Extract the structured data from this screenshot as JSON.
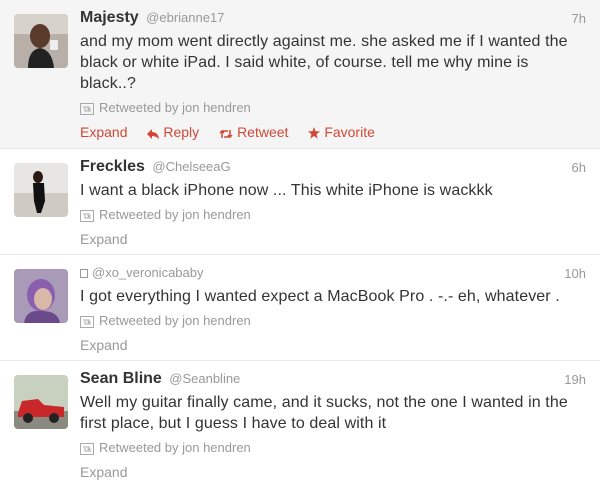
{
  "tweets": [
    {
      "fullname": "Majesty",
      "username": "@ebrianne17",
      "time": "7h",
      "text": "and my mom went directly against me. she asked me if I wanted the black or white iPad. I said white, of course. tell me why mine is black..?",
      "retweeted_by": "Retweeted by jon hendren",
      "actions": {
        "expand": "Expand",
        "reply": "Reply",
        "retweet": "Retweet",
        "favorite": "Favorite"
      }
    },
    {
      "fullname": "Freckles",
      "username": "@ChelseeaG",
      "time": "6h",
      "text": "I want a black iPhone now ... This white iPhone is wackkk",
      "retweeted_by": "Retweeted by jon hendren",
      "actions": {
        "expand": "Expand"
      }
    },
    {
      "fullname": "",
      "username": "@xo_veronicababy",
      "time": "10h",
      "text": "I got everything I wanted expect a MacBook Pro . -.- eh, whatever .",
      "retweeted_by": "Retweeted by jon hendren",
      "actions": {
        "expand": "Expand"
      }
    },
    {
      "fullname": "Sean Bline",
      "username": "@Seanbline",
      "time": "19h",
      "text": "Well my guitar finally came, and it sucks, not the one I wanted in the first place, but I guess I have to deal with it",
      "retweeted_by": "Retweeted by jon hendren",
      "actions": {
        "expand": "Expand"
      }
    }
  ],
  "colors": {
    "action_accent": "#d14836",
    "muted": "#999999",
    "highlight_bg": "#f5f5f5"
  },
  "icons": {
    "retweet_small": "retweet-box-icon",
    "reply": "reply-arrow-icon",
    "retweet": "retweet-icon",
    "favorite": "star-icon"
  }
}
